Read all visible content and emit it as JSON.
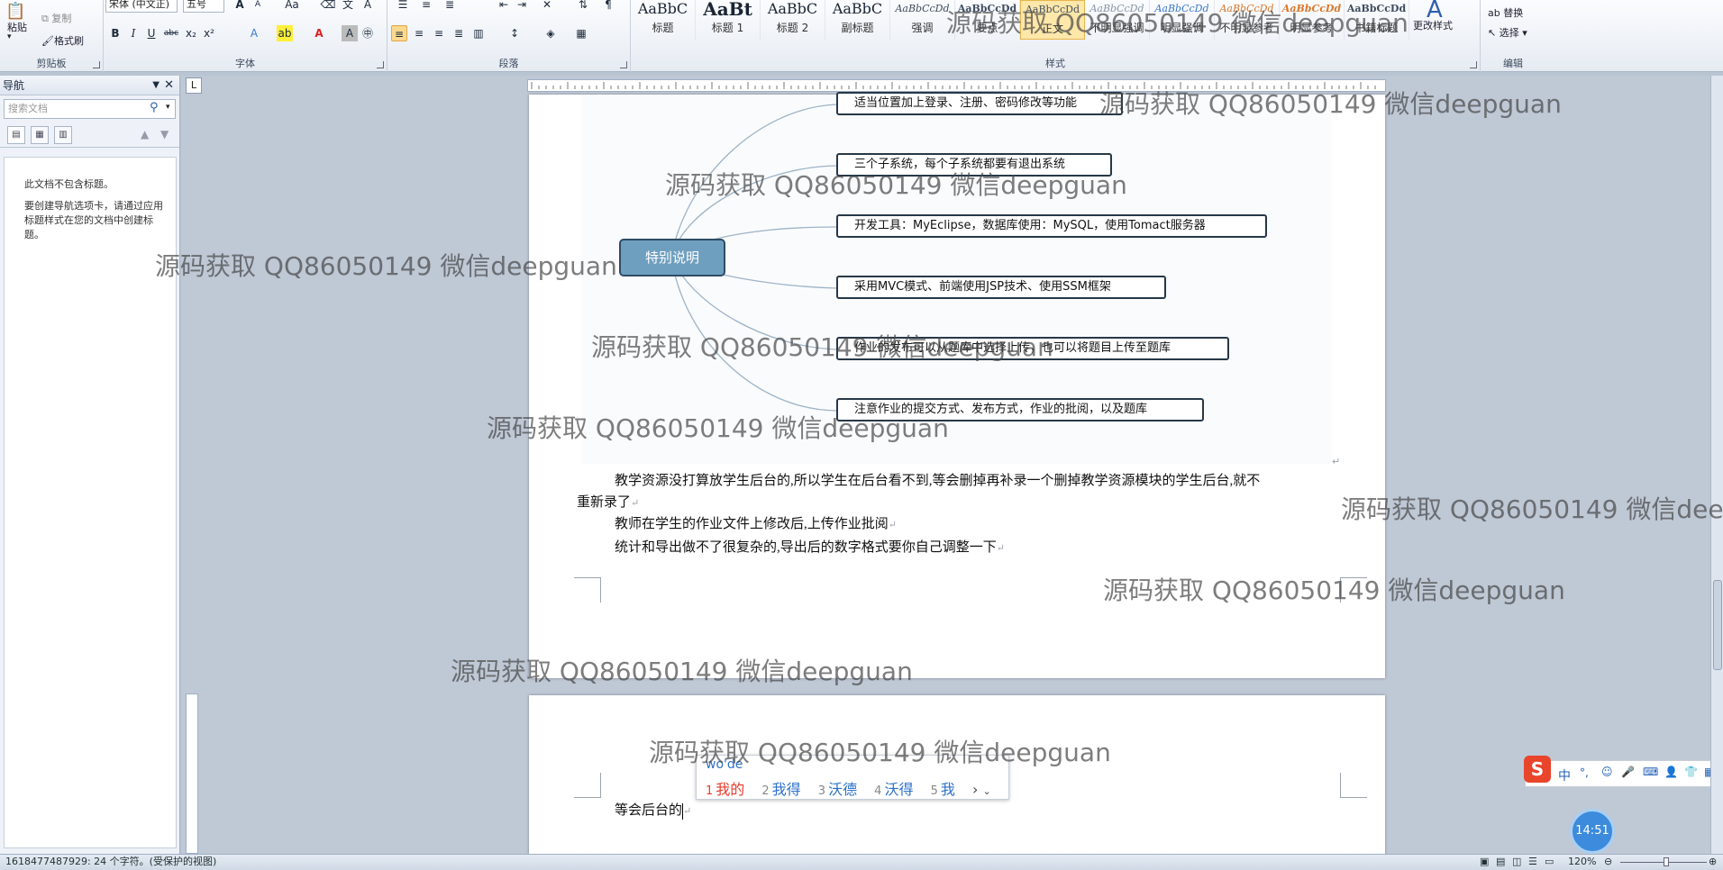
{
  "ribbon": {
    "clipboard": {
      "paste": "粘贴",
      "copy": "复制",
      "format_painter": "格式刷",
      "label": "剪贴板"
    },
    "font": {
      "font_name": "宋体 (中文正)",
      "font_size": "五号",
      "label": "字体"
    },
    "paragraph": {
      "label": "段落"
    },
    "styles": {
      "label": "样式",
      "items": [
        {
          "preview": "AaBbC",
          "name": "标题"
        },
        {
          "preview": "AaBt",
          "name": "标题 1"
        },
        {
          "preview": "AaBbC",
          "name": "标题 2"
        },
        {
          "preview": "AaBbC",
          "name": "副标题"
        },
        {
          "preview": "AaBbCcDd",
          "name": "强调"
        },
        {
          "preview": "AaBbCcDd",
          "name": "要点"
        },
        {
          "preview": "AaBbCcDd",
          "name": "正文"
        },
        {
          "preview": "AaBbCcDd",
          "name": "不明显强调"
        },
        {
          "preview": "AaBbCcDd",
          "name": "明显强调"
        },
        {
          "preview": "AaBbCcDd",
          "name": "不明显参考"
        },
        {
          "preview": "AaBbCcDd",
          "name": "明显参考"
        },
        {
          "preview": "AaBbCcDd",
          "name": "书籍标题"
        }
      ],
      "change_styles": "更改样式"
    },
    "editing": {
      "replace": "替换",
      "select": "选择",
      "label": "编辑"
    }
  },
  "nav": {
    "title": "导航",
    "search_placeholder": "搜索文档",
    "no_headings": "此文档不包含标题。",
    "hint": "要创建导航选项卡，请通过应用标题样式在您的文档中创建标题。"
  },
  "mindmap": {
    "root": "特别说明",
    "branches": [
      "适当位置加上登录、注册、密码修改等功能",
      "三个子系统，每个子系统都要有退出系统",
      "开发工具：MyEclipse，数据库使用：MySQL，使用Tomact服务器",
      "采用MVC模式、前端使用JSP技术、使用SSM框架",
      "作业的发布可以从题库中选择上传，也可以将题目上传至题库",
      "注意作业的提交方式、发布方式，作业的批阅，以及题库"
    ]
  },
  "body": {
    "para1_line1": "教学资源没打算放学生后台的,所以学生在后台看不到,等会删掉再补录一个删掉教学资源模块的学生后台,就不",
    "para1_line2": "重新录了",
    "para2": "教师在学生的作业文件上修改后,上传作业批阅",
    "para3": "统计和导出做不了很复杂的,导出后的数字格式要你自己调整一下",
    "page2_text": "等会后台的"
  },
  "ime": {
    "composition": "wo'de",
    "candidates": [
      {
        "n": "1",
        "text": "我的"
      },
      {
        "n": "2",
        "text": "我得"
      },
      {
        "n": "3",
        "text": "沃德"
      },
      {
        "n": "4",
        "text": "沃得"
      },
      {
        "n": "5",
        "text": "我"
      }
    ],
    "toolbar_text": "中"
  },
  "clock": "14:51",
  "status": {
    "info": "1618477487929: 24 个字符。(受保护的视图)",
    "zoom": "120%"
  },
  "watermark": "源码获取 QQ86050149 微信deepguan",
  "colors": {
    "mindmap_root": "#6f9fbf",
    "ime_highlight": "#e53c2b",
    "ime_text": "#2b70c9"
  }
}
